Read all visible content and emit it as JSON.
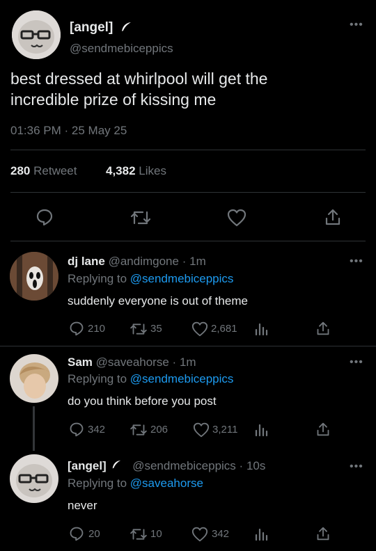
{
  "main_tweet": {
    "name": "[angel]",
    "handle": "@sendmebiceppics",
    "text_line1": "best dressed at whirlpool will get the",
    "text_line2": "incredible prize of kissing me",
    "time": "01:36 PM",
    "date": "25 May 25",
    "retweets": "280",
    "retweets_label": "Retweet",
    "likes": "4,382",
    "likes_label": "Likes",
    "menu": "•••"
  },
  "replies": [
    {
      "name": "dj lane",
      "handle": "@andimgone",
      "age": "1m",
      "replying_to_label": "Replying to",
      "replying_to": "@sendmebiceppics",
      "text": "suddenly everyone is out of theme",
      "replies": "210",
      "retweets": "35",
      "likes": "2,681"
    },
    {
      "name": "Sam",
      "handle": "@saveahorse",
      "age": "1m",
      "replying_to_label": "Replying to",
      "replying_to": "@sendmebiceppics",
      "text": "do you think before you post",
      "replies": "342",
      "retweets": "206",
      "likes": "3,211"
    },
    {
      "name": "[angel]",
      "handle": "@sendmebiceppics",
      "age": "10s",
      "replying_to_label": "Replying to",
      "replying_to": "@saveahorse",
      "text": "never",
      "replies": "20",
      "retweets": "10",
      "likes": "342"
    }
  ],
  "separators": {
    "dot": "·"
  },
  "colors": {
    "background": "#000000",
    "text": "#e7e9ea",
    "muted": "#71767b",
    "link": "#1d9bf0",
    "divider": "#2f3336"
  }
}
